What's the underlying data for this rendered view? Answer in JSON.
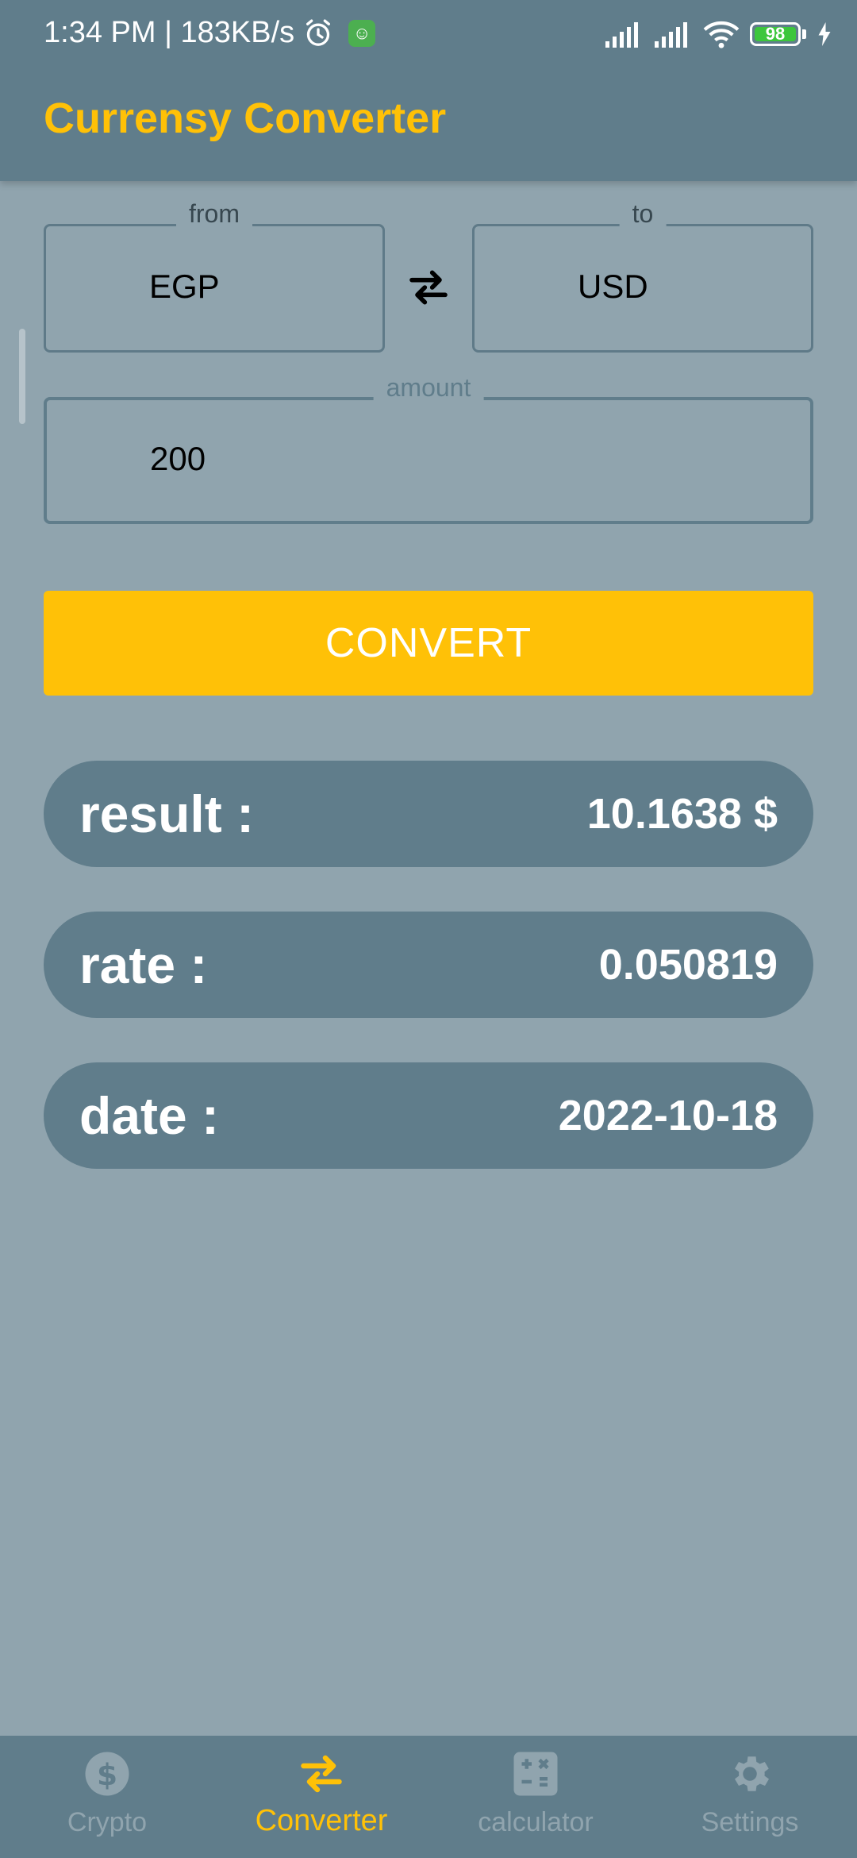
{
  "status_bar": {
    "left_text": "1:34 PM | 183KB/s",
    "battery": "98"
  },
  "app_bar": {
    "title": "Currensy Converter"
  },
  "form": {
    "from": {
      "label": "from",
      "value": "EGP"
    },
    "to": {
      "label": "to",
      "value": "USD"
    },
    "amount": {
      "label": "amount",
      "value": "200"
    },
    "convert_label": "CONVERT"
  },
  "results": {
    "result": {
      "label": "result :",
      "value": "10.1638 $"
    },
    "rate": {
      "label": "rate :",
      "value": "0.050819"
    },
    "date": {
      "label": "date :",
      "value": "2022-10-18"
    }
  },
  "bottom_nav": {
    "items": [
      {
        "label": "Crypto",
        "icon": "dollar-circle-icon"
      },
      {
        "label": "Converter",
        "icon": "swap-icon",
        "active": true
      },
      {
        "label": "calculator",
        "icon": "calculator-icon"
      },
      {
        "label": "Settings",
        "icon": "gear-icon"
      }
    ]
  },
  "colors": {
    "primary": "#607d8b",
    "background": "#90a4ae",
    "accent": "#ffc107"
  }
}
